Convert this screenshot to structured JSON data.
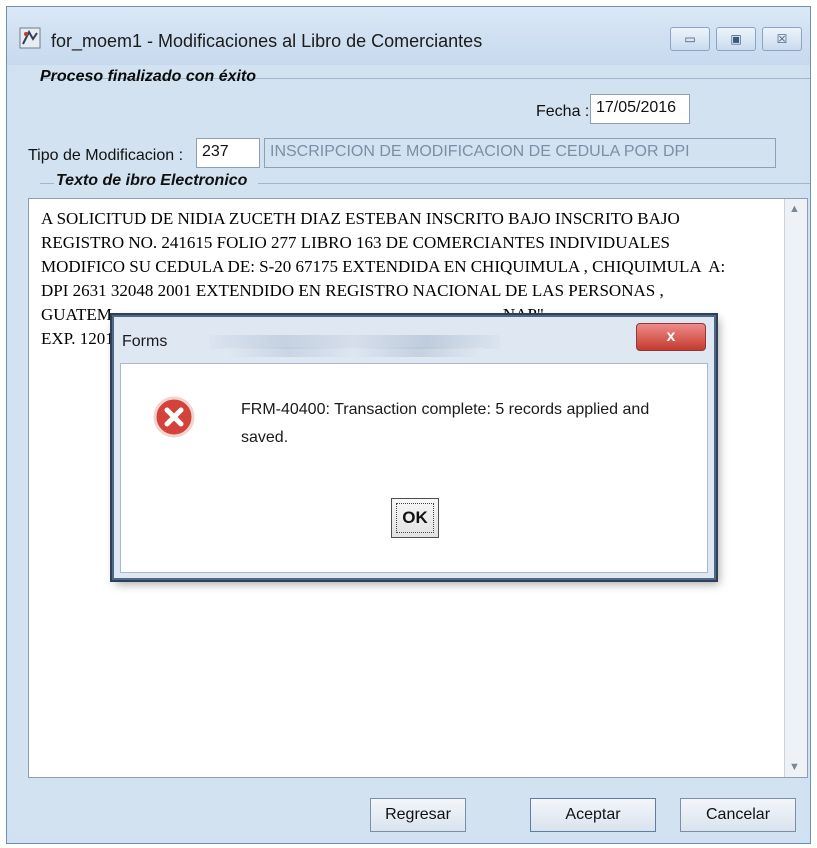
{
  "window": {
    "title": "for_moem1 - Modificaciones al Libro de Comerciantes",
    "minimize": "▭",
    "maximize": "▣",
    "close": "☒"
  },
  "status_message": "Proceso finalizado con éxito",
  "fecha": {
    "label": "Fecha :",
    "value": "17/05/2016"
  },
  "tipo_modificacion": {
    "label": "Tipo de Modificacion :",
    "code": "237",
    "description": "INSCRIPCION DE MODIFICACION DE CEDULA POR DPI"
  },
  "texto_libro": {
    "heading": "Texto de ibro Electronico",
    "content": "A SOLICITUD DE NIDIA ZUCETH DIAZ ESTEBAN INSCRITO BAJO INSCRITO BAJO\nREGISTRO NO. 241615 FOLIO 277 LIBRO 163 DE COMERCIANTES INDIVIDUALES\nMODIFICO SU CEDULA DE: S-20 67175 EXTENDIDA EN CHIQUIMULA , CHIQUIMULA  A:\nDPI 2631 32048 2001 EXTENDIDO EN REGISTRO NACIONAL DE LAS PERSONAS ,\nGUATEM                                                                                            NAP\".\nEXP. 1201"
  },
  "buttons": {
    "regresar": "Regresar",
    "aceptar": "Aceptar",
    "cancelar": "Cancelar"
  },
  "dialog": {
    "title": "Forms",
    "close": "x",
    "message": "FRM-40400:  Transaction complete: 5 records applied and saved.",
    "ok": "OK",
    "icon": "error-icon"
  }
}
